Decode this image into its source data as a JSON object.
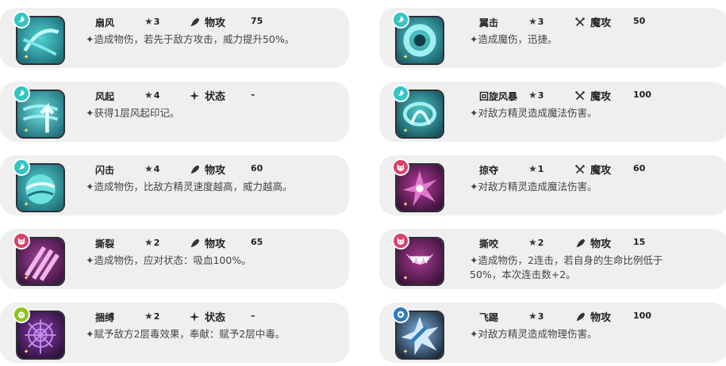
{
  "skills": [
    {
      "name": "扇风",
      "star_label": "3",
      "category": "物攻",
      "power": "75",
      "desc": "✦造成物伤，若先于敌方攻击，威力提升50%。",
      "element": "wind",
      "art": "wind-swirl-icon",
      "category_icon": "physical"
    },
    {
      "name": "翼击",
      "star_label": "3",
      "category": "魔攻",
      "power": "50",
      "desc": "✦造成魔伤，迅捷。",
      "element": "wind",
      "art": "wind-ring-icon",
      "category_icon": "magic"
    },
    {
      "name": "风起",
      "star_label": "4",
      "category": "状态",
      "power": "–",
      "desc": "✦获得1层风起印记。",
      "element": "wind",
      "art": "wind-rise-icon",
      "category_icon": "status"
    },
    {
      "name": "回旋风暴",
      "star_label": "3",
      "category": "魔攻",
      "power": "100",
      "desc": "✦对敌方精灵造成魔法伤害。",
      "element": "wind",
      "art": "whirlwind-icon",
      "category_icon": "magic"
    },
    {
      "name": "闪击",
      "star_label": "4",
      "category": "物攻",
      "power": "60",
      "desc": "✦造成物伤，比敌方精灵速度越高，威力越高。",
      "element": "wind",
      "art": "wind-orb-icon",
      "category_icon": "physical"
    },
    {
      "name": "掠夺",
      "star_label": "1",
      "category": "魔攻",
      "power": "60",
      "desc": "✦对敌方精灵造成魔法伤害。",
      "element": "demon",
      "art": "dark-burst-icon",
      "category_icon": "magic"
    },
    {
      "name": "撕裂",
      "star_label": "2",
      "category": "物攻",
      "power": "65",
      "desc": "✦造成物伤，应对状态：吸血100%。",
      "element": "demon",
      "art": "claw-slash-icon",
      "category_icon": "physical"
    },
    {
      "name": "撕咬",
      "star_label": "2",
      "category": "物攻",
      "power": "15",
      "desc": "✦造成物伤，2连击，若自身的生命比例低于50%，本次连击数+2。",
      "element": "demon",
      "art": "bite-fangs-icon",
      "category_icon": "physical"
    },
    {
      "name": "捆缚",
      "star_label": "2",
      "category": "状态",
      "power": "–",
      "desc": "✦赋予敌方2层毒效果，奉献：赋予2层中毒。",
      "element": "poison",
      "art": "spider-web-icon",
      "category_icon": "status"
    },
    {
      "name": "飞踢",
      "star_label": "3",
      "category": "物攻",
      "power": "100",
      "desc": "✦对敌方精灵造成物理伤害。",
      "element": "normal",
      "art": "kick-impact-icon",
      "category_icon": "physical"
    }
  ],
  "colors": {
    "wind": "#36c3c3",
    "demon": "#d9426a",
    "poison": "#8fc31f",
    "normal": "#2f7bbf"
  }
}
